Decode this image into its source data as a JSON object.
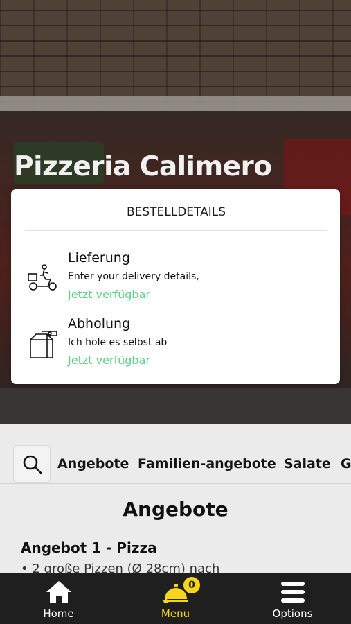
{
  "header": {
    "title": "Pizzeria Calimero"
  },
  "order_card": {
    "heading": "BESTELLDETAILS",
    "options": [
      {
        "title": "Lieferung",
        "description": "Enter your delivery details,",
        "status": "Jetzt verfügbar",
        "icon": "delivery-scooter-icon"
      },
      {
        "title": "Abholung",
        "description": "Ich hole es selbst ab",
        "status": "Jetzt verfügbar",
        "icon": "takeaway-bag-icon"
      }
    ],
    "status_color": "#5fd184"
  },
  "categories": {
    "search_icon": "search-icon",
    "items": [
      "Angebote",
      "Familien-angebote",
      "Salate",
      "G"
    ]
  },
  "section": {
    "title": "Angebote",
    "item_title": "Angebot 1 - Pizza",
    "item_line": "• 2 große Pizzen (Ø 28cm) nach"
  },
  "bottom_nav": {
    "items": [
      {
        "label": "Home",
        "icon": "home-icon"
      },
      {
        "label": "Menu",
        "icon": "cloche-icon",
        "badge": "0"
      },
      {
        "label": "Options",
        "icon": "hamburger-menu-icon"
      }
    ],
    "accent_color": "#f7d51a"
  }
}
